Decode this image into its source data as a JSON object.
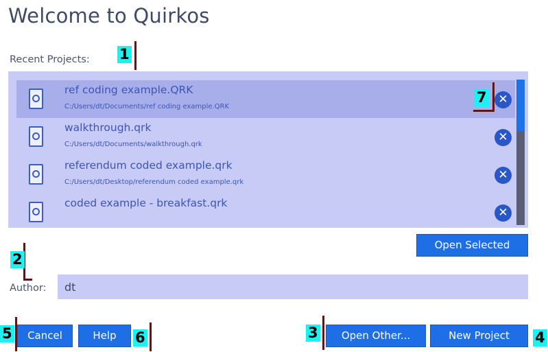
{
  "dialog": {
    "title": "Welcome to Quirkos",
    "recent_label": "Recent Projects:",
    "author_label": "Author:",
    "author_value": "dt"
  },
  "projects": [
    {
      "name": "ref coding example.QRK",
      "path": "C:/Users/dt/Documents/ref coding example.QRK",
      "selected": true
    },
    {
      "name": "walkthrough.qrk",
      "path": "C:/Users/dt/Documents/walkthrough.qrk",
      "selected": false
    },
    {
      "name": "referendum coded example.qrk",
      "path": "C:/Users/dt/Desktop/referendum coded example.qrk",
      "selected": false
    },
    {
      "name": "coded example - breakfast.qrk",
      "path": "",
      "selected": false
    }
  ],
  "buttons": {
    "open_selected": "Open Selected",
    "cancel": "Cancel",
    "help": "Help",
    "open_other": "Open Other...",
    "new_project": "New Project",
    "remove_glyph": "✕"
  },
  "callouts": [
    "1",
    "2",
    "3",
    "4",
    "5",
    "6",
    "7"
  ],
  "colors": {
    "accent": "#1e6fe6",
    "list_background": "#c7cbf5",
    "selected_row": "#a8aeea",
    "callout": "#18f2f2"
  },
  "icons": [
    "file-icon",
    "remove-icon"
  ]
}
